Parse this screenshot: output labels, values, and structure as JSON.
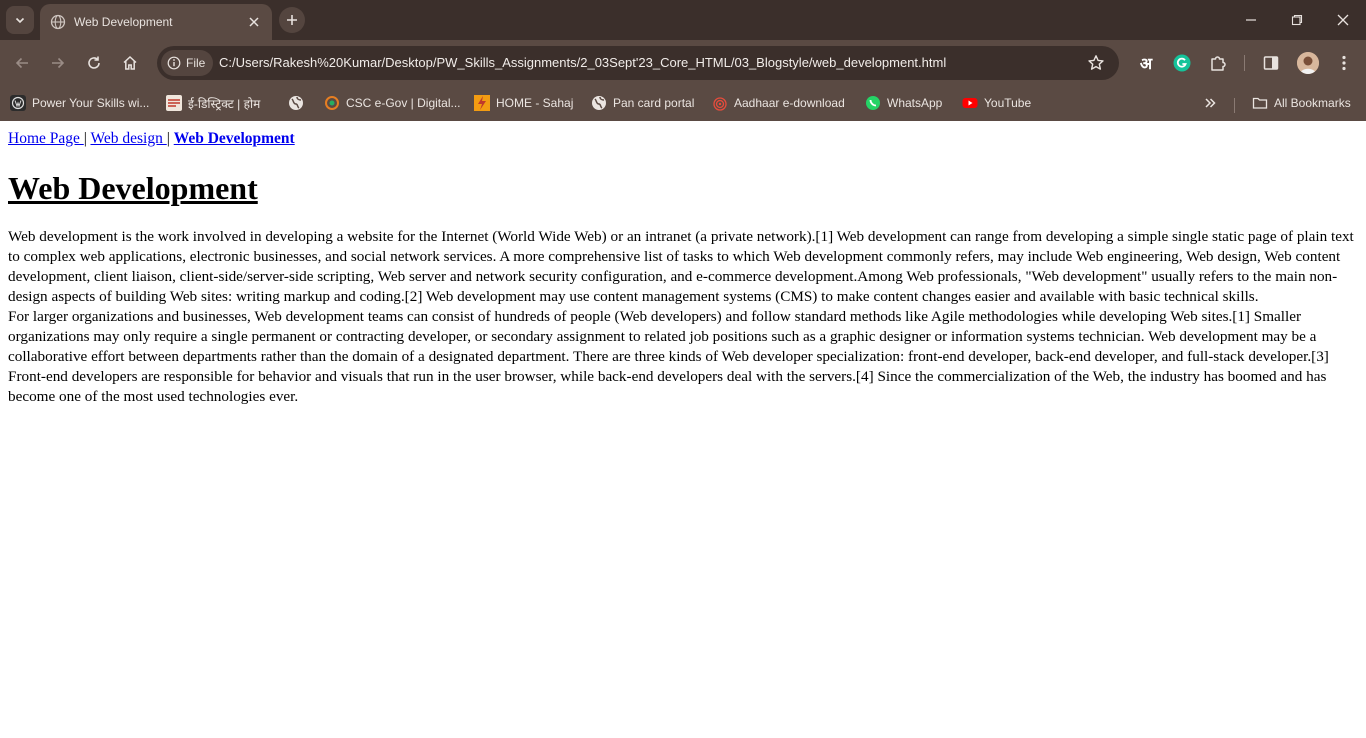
{
  "browser": {
    "tab_title": "Web Development",
    "file_chip": "File",
    "url": "C:/Users/Rakesh%20Kumar/Desktop/PW_Skills_Assignments/2_03Sept'23_Core_HTML/03_Blogstyle/web_development.html",
    "ext_hindi": "अ",
    "bookmarks": [
      {
        "label": "Power Your Skills wi...",
        "icon": "wordpress-icon"
      },
      {
        "label": "ई-डिस्ट्रिक्ट | होम",
        "icon": "edistrict-icon"
      },
      {
        "label": "",
        "icon": "globe-icon"
      },
      {
        "label": "CSC e-Gov | Digital...",
        "icon": "csc-icon"
      },
      {
        "label": "HOME - Sahaj",
        "icon": "sahaj-icon"
      },
      {
        "label": "Pan card portal",
        "icon": "globe-icon"
      },
      {
        "label": "Aadhaar e-download",
        "icon": "aadhaar-icon"
      },
      {
        "label": "WhatsApp",
        "icon": "whatsapp-icon"
      },
      {
        "label": "YouTube",
        "icon": "youtube-icon"
      }
    ],
    "all_bookmarks": "All Bookmarks"
  },
  "page": {
    "nav": {
      "home": "Home Page ",
      "sep1": "|",
      "design": "Web design ",
      "sep2": "|",
      "dev": "Web Development"
    },
    "heading": "Web Development",
    "paragraph1": "Web development is the work involved in developing a website for the Internet (World Wide Web) or an intranet (a private network).[1] Web development can range from developing a simple single static page of plain text to complex web applications, electronic businesses, and social network services. A more comprehensive list of tasks to which Web development commonly refers, may include Web engineering, Web design, Web content development, client liaison, client-side/server-side scripting, Web server and network security configuration, and e-commerce development.Among Web professionals, \"Web development\" usually refers to the main non-design aspects of building Web sites: writing markup and coding.[2] Web development may use content management systems (CMS) to make content changes easier and available with basic technical skills.",
    "paragraph2": "For larger organizations and businesses, Web development teams can consist of hundreds of people (Web developers) and follow standard methods like Agile methodologies while developing Web sites.[1] Smaller organizations may only require a single permanent or contracting developer, or secondary assignment to related job positions such as a graphic designer or information systems technician. Web development may be a collaborative effort between departments rather than the domain of a designated department. There are three kinds of Web developer specialization: front-end developer, back-end developer, and full-stack developer.[3] Front-end developers are responsible for behavior and visuals that run in the user browser, while back-end developers deal with the servers.[4] Since the commercialization of the Web, the industry has boomed and has become one of the most used technologies ever."
  },
  "colors": {
    "frame_dark": "#3b2f2b",
    "frame": "#5a4a43",
    "link": "#0000ee"
  }
}
